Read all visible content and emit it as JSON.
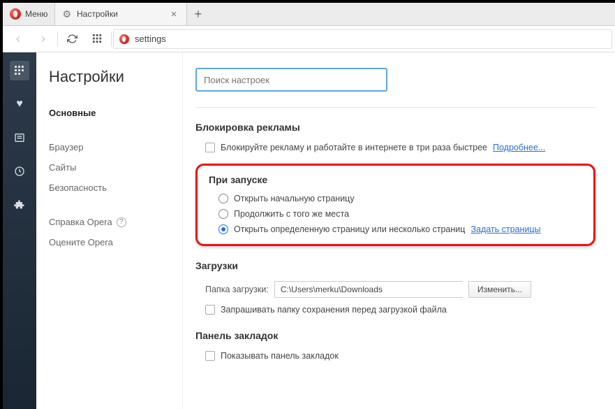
{
  "titlebar": {
    "menu_label": "Меню",
    "tab_title": "Настройки"
  },
  "toolbar": {
    "url_text": "settings"
  },
  "sidenav": {
    "title": "Настройки",
    "items": [
      {
        "label": "Основные",
        "active": true
      },
      {
        "label": "Браузер",
        "active": false
      },
      {
        "label": "Сайты",
        "active": false
      },
      {
        "label": "Безопасность",
        "active": false
      }
    ],
    "help_label": "Справка Opera",
    "rate_label": "Оцените Opera"
  },
  "content": {
    "search_placeholder": "Поиск настроек",
    "adblock": {
      "heading": "Блокировка рекламы",
      "checkbox_label": "Блокируйте рекламу и работайте в интернете в три раза быстрее",
      "more_link": "Подробнее..."
    },
    "startup": {
      "heading": "При запуске",
      "options": [
        {
          "label": "Открыть начальную страницу",
          "checked": false
        },
        {
          "label": "Продолжить с того же места",
          "checked": false
        },
        {
          "label": "Открыть определенную страницу или несколько страниц",
          "checked": true
        }
      ],
      "set_pages_link": "Задать страницы"
    },
    "downloads": {
      "heading": "Загрузки",
      "folder_label": "Папка загрузки:",
      "folder_path": "C:\\Users\\merku\\Downloads",
      "change_button": "Изменить...",
      "ask_label": "Запрашивать папку сохранения перед загрузкой файла"
    },
    "bookmarks_bar": {
      "heading": "Панель закладок",
      "show_label": "Показывать панель закладок"
    }
  }
}
